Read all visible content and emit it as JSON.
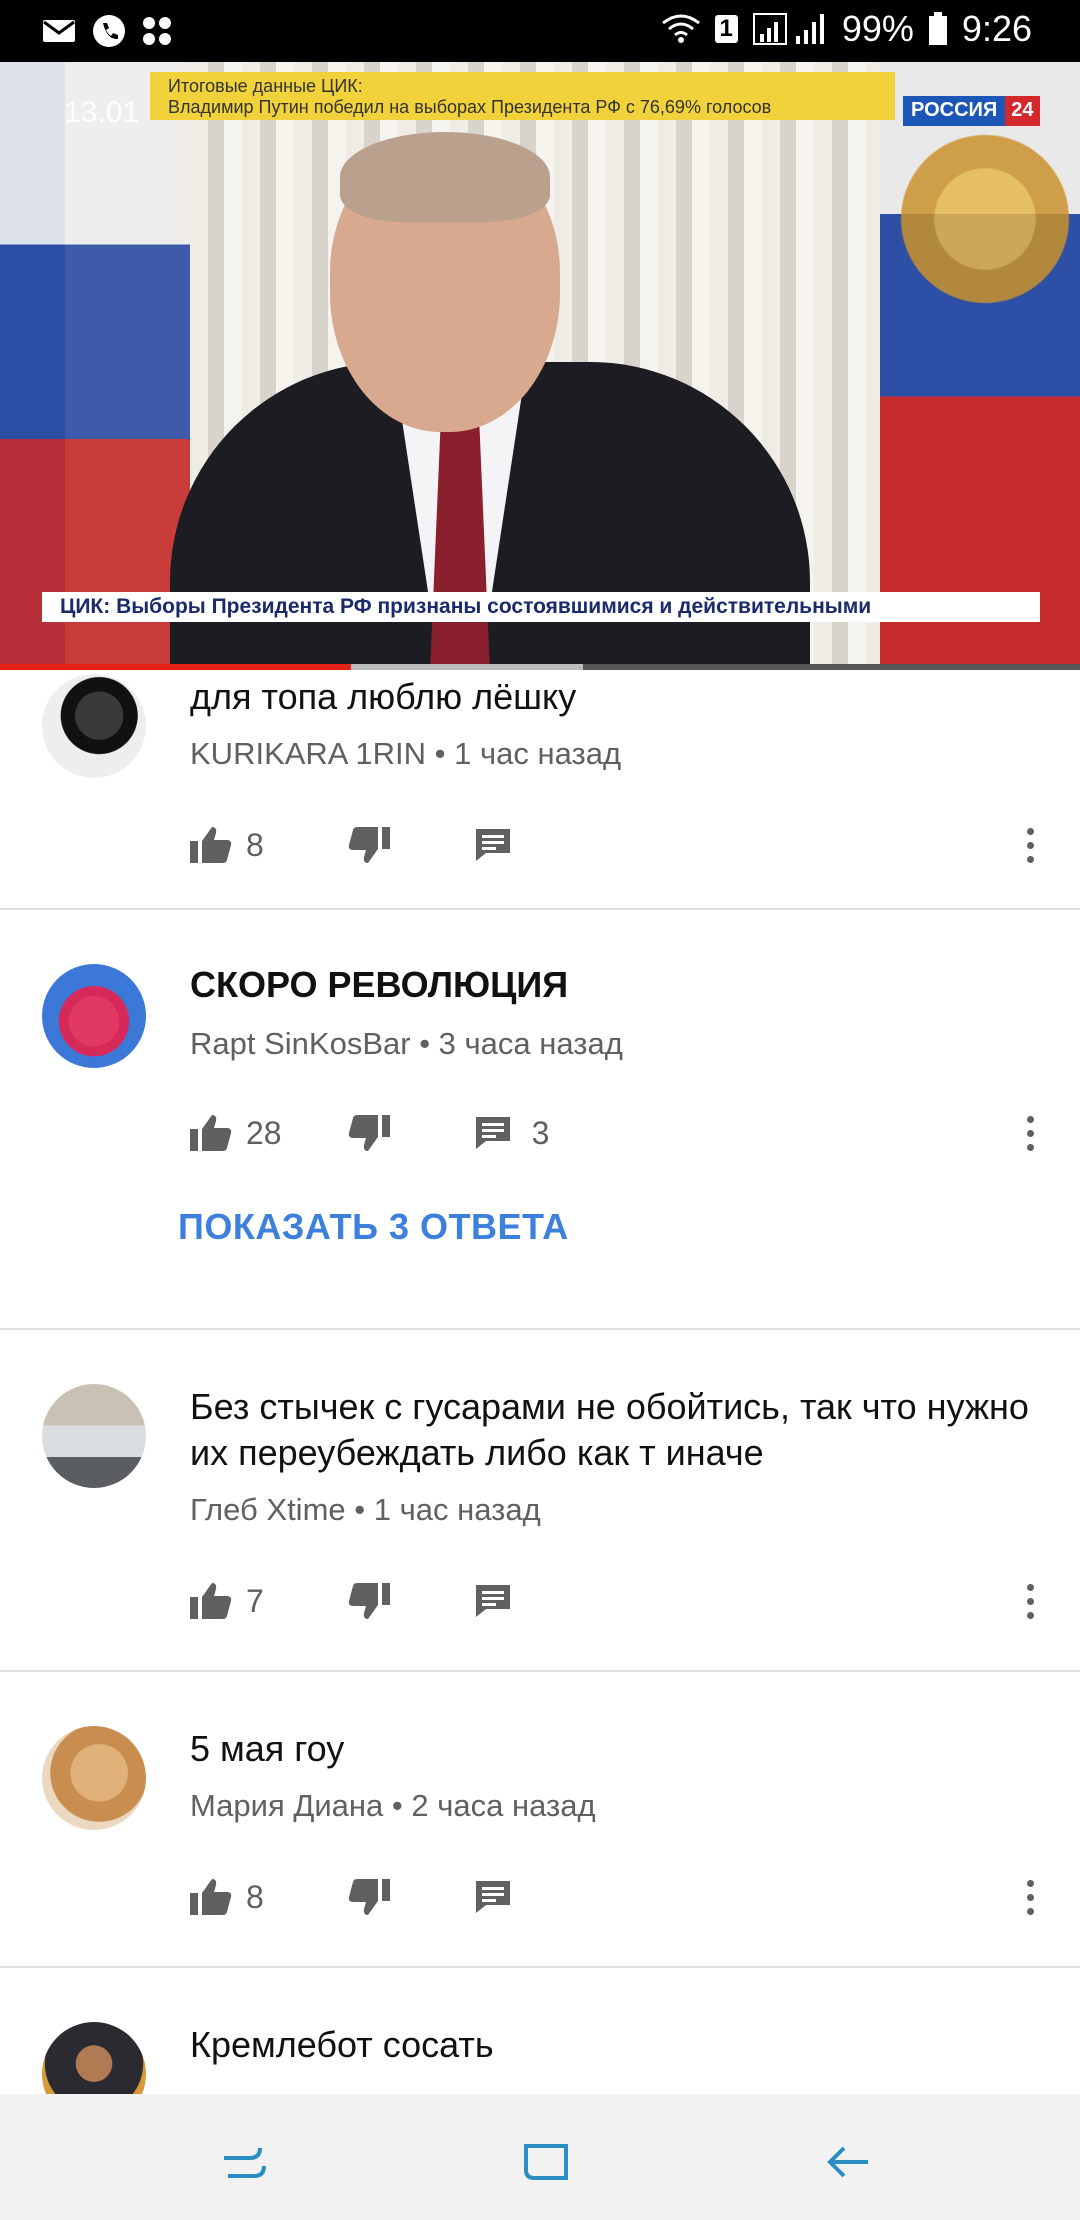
{
  "status_bar": {
    "battery": "99%",
    "time": "9:26",
    "sim_badge": "1",
    "icons": [
      "mail-icon",
      "phone-icon",
      "apps-icon",
      "wifi-icon",
      "signal-icon",
      "battery-icon"
    ]
  },
  "video": {
    "date": "13.01",
    "headline_top_line1": "Итоговые данные ЦИК:",
    "headline_top_line2": "Владимир Путин победил на выборах Президента РФ с 76,69% голосов",
    "channel_name": "РОССИЯ",
    "channel_number": "24",
    "headline_bottom": "ЦИК: Выборы Президента РФ признаны состоявшимися и действительными",
    "progress": 0.325,
    "buffered": 0.54
  },
  "comments": [
    {
      "text": "для топа люблю лёшку",
      "author": "KURIKARA 1RIN",
      "time": "1 час назад",
      "likes": "8",
      "replies": "",
      "bold": false
    },
    {
      "text": "СКОРО РЕВОЛЮЦИЯ",
      "author": "Rapt SinKosBar",
      "time": "3 часа назад",
      "likes": "28",
      "replies": "3",
      "bold": true,
      "show_replies": "ПОКАЗАТЬ 3 ОТВЕТА"
    },
    {
      "text": "Без стычек с гусарами не обойтись, так что нужно их переубеждать либо как т иначе",
      "author": "Глеб Xtime",
      "time": "1 час назад",
      "likes": "7",
      "replies": "",
      "bold": false
    },
    {
      "text": "5 мая гоу",
      "author": "Мария Диана",
      "time": "2 часа назад",
      "likes": "8",
      "replies": "",
      "bold": false
    },
    {
      "text": "Кремлебот сосать",
      "author": "",
      "time": "",
      "likes": "",
      "replies": "",
      "bold": false
    }
  ],
  "meta_separator": "•",
  "colors": {
    "accent_blue": "#3d7fdc",
    "progress_red": "#e62117",
    "secondary_text": "#606060"
  },
  "nav_bar": {
    "icons": [
      "recent-apps-icon",
      "home-icon",
      "back-icon"
    ]
  }
}
